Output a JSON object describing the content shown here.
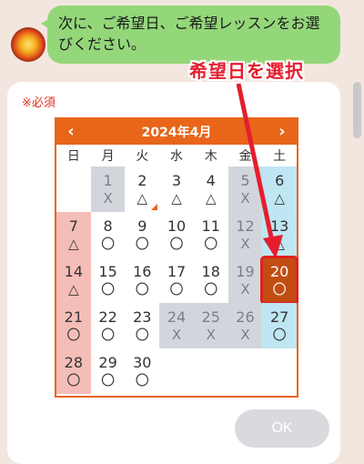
{
  "chat": {
    "message": "次に、ご希望日、ご希望レッスンをお選びください。"
  },
  "form": {
    "required_label": "※必須",
    "ok_label": "OK"
  },
  "calendar": {
    "month_label": "2024年4月",
    "prev_icon": "‹",
    "next_icon": "›",
    "weekdays": [
      "日",
      "月",
      "火",
      "水",
      "木",
      "金",
      "土"
    ],
    "weeks": [
      [
        {
          "day": "",
          "status": "",
          "type": "empty"
        },
        {
          "day": "1",
          "status": "X",
          "type": "past"
        },
        {
          "day": "2",
          "status": "△",
          "type": "normal",
          "corner": true
        },
        {
          "day": "3",
          "status": "△",
          "type": "normal"
        },
        {
          "day": "4",
          "status": "△",
          "type": "normal"
        },
        {
          "day": "5",
          "status": "X",
          "type": "past"
        },
        {
          "day": "6",
          "status": "△",
          "type": "sat"
        }
      ],
      [
        {
          "day": "7",
          "status": "△",
          "type": "sun"
        },
        {
          "day": "8",
          "status": "〇",
          "type": "normal"
        },
        {
          "day": "9",
          "status": "〇",
          "type": "normal"
        },
        {
          "day": "10",
          "status": "〇",
          "type": "normal"
        },
        {
          "day": "11",
          "status": "〇",
          "type": "normal"
        },
        {
          "day": "12",
          "status": "X",
          "type": "past"
        },
        {
          "day": "13",
          "status": "△",
          "type": "sat"
        }
      ],
      [
        {
          "day": "14",
          "status": "△",
          "type": "sun"
        },
        {
          "day": "15",
          "status": "〇",
          "type": "normal"
        },
        {
          "day": "16",
          "status": "〇",
          "type": "normal"
        },
        {
          "day": "17",
          "status": "〇",
          "type": "normal"
        },
        {
          "day": "18",
          "status": "〇",
          "type": "normal"
        },
        {
          "day": "19",
          "status": "X",
          "type": "past"
        },
        {
          "day": "20",
          "status": "〇",
          "type": "selected"
        }
      ],
      [
        {
          "day": "21",
          "status": "〇",
          "type": "sun"
        },
        {
          "day": "22",
          "status": "〇",
          "type": "normal"
        },
        {
          "day": "23",
          "status": "〇",
          "type": "normal"
        },
        {
          "day": "24",
          "status": "X",
          "type": "full"
        },
        {
          "day": "25",
          "status": "X",
          "type": "full"
        },
        {
          "day": "26",
          "status": "X",
          "type": "full"
        },
        {
          "day": "27",
          "status": "〇",
          "type": "sat"
        }
      ],
      [
        {
          "day": "28",
          "status": "〇",
          "type": "sun"
        },
        {
          "day": "29",
          "status": "〇",
          "type": "normal"
        },
        {
          "day": "30",
          "status": "〇",
          "type": "normal"
        },
        {
          "day": "",
          "status": "",
          "type": "empty"
        },
        {
          "day": "",
          "status": "",
          "type": "empty"
        },
        {
          "day": "",
          "status": "",
          "type": "empty"
        },
        {
          "day": "",
          "status": "",
          "type": "empty"
        }
      ]
    ]
  },
  "annotation": {
    "text": "希望日を選択",
    "color": "#e41e2f"
  },
  "colors": {
    "accent": "#e8651a",
    "bubble": "#94d77a",
    "selected": "#c24d13"
  }
}
